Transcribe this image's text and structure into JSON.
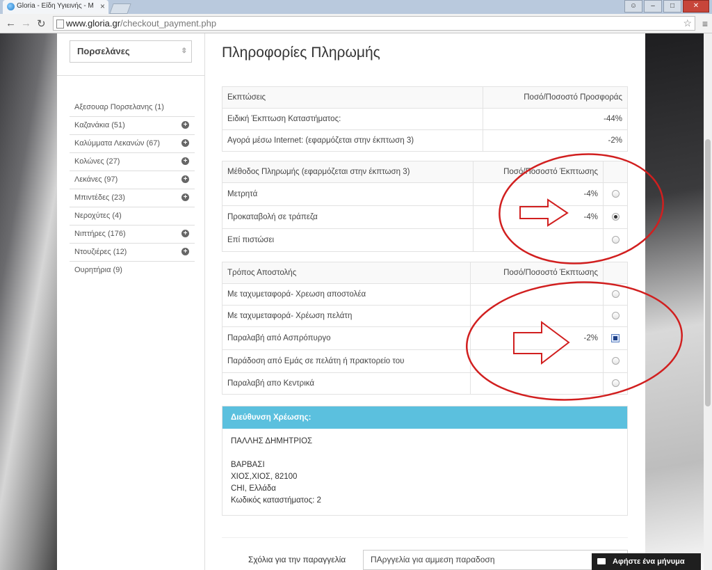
{
  "browser": {
    "tab_title": "Gloria - Είδη Υγιεινής - Μ",
    "url_domain": "www.gloria.gr",
    "url_path": "/checkout_payment.php"
  },
  "sidebar": {
    "category_select": "Πορσελάνες",
    "items": [
      {
        "label": "Αξεσουαρ Πορσελανης (1)",
        "expandable": false
      },
      {
        "label": "Καζανάκια (51)",
        "expandable": true
      },
      {
        "label": "Καλύμματα Λεκανών (67)",
        "expandable": true
      },
      {
        "label": "Κολώνες (27)",
        "expandable": true
      },
      {
        "label": "Λεκάνες (97)",
        "expandable": true
      },
      {
        "label": "Μπιντέδες (23)",
        "expandable": true
      },
      {
        "label": "Νεροχύτες (4)",
        "expandable": false
      },
      {
        "label": "Νιπτήρες (176)",
        "expandable": true
      },
      {
        "label": "Ντουζιέρες (12)",
        "expandable": true
      },
      {
        "label": "Ουρητήρια (9)",
        "expandable": false
      }
    ]
  },
  "main": {
    "title": "Πληροφορίες Πληρωμής",
    "discounts": {
      "header_left": "Εκπτώσεις",
      "header_right": "Ποσό/Ποσοστό Προσφοράς",
      "rows": [
        {
          "label": "Ειδική Έκπτωση Καταστήματος:",
          "value": "-44%"
        },
        {
          "label": "Αγορά μέσω Internet: (εφαρμόζεται στην έκπτωση 3)",
          "value": "-2%"
        }
      ]
    },
    "payment": {
      "header_left": "Μέθοδος Πληρωμής (εφαρμόζεται στην έκπτωση 3)",
      "header_right": "Ποσό/Ποσοστό Έκπτωσης",
      "rows": [
        {
          "label": "Μετρητά",
          "value": "-4%"
        },
        {
          "label": "Προκαταβολή σε τράπεζα",
          "value": "-4%"
        },
        {
          "label": "Επί πιστώσει",
          "value": ""
        }
      ]
    },
    "shipping": {
      "header_left": "Τρόπος Αποστολής",
      "header_right": "Ποσό/Ποσοστό Έκπτωσης",
      "rows": [
        {
          "label": "Με ταχυμεταφορά- Χρεωση αποστολέα",
          "value": ""
        },
        {
          "label": "Με ταχυμεταφορά- Χρέωση πελάτη",
          "value": ""
        },
        {
          "label": "Παραλαβή από Ασπρόπυργο",
          "value": "-2%"
        },
        {
          "label": "Παράδοση από Εμάς σε πελάτη ή πρακτορείο του",
          "value": ""
        },
        {
          "label": "Παραλαβή απο Κεντρικά",
          "value": ""
        }
      ]
    },
    "billing": {
      "header": "Διεύθυνση Χρέωσης:",
      "name": "ΠΑΛΛΗΣ ΔΗΜΗΤΡΙΟΣ",
      "line1": "ΒΑΡΒΑΣΙ",
      "line2": "ΧΙΟΣ,ΧΙΟΣ, 82100",
      "line3": "CHI, Ελλάδα",
      "line4": "Κωδικός καταστήματος: 2"
    },
    "notes": {
      "label": "Σχόλια για την παραγγελία",
      "value": "ΠΑργγελία για αμμεση παραδοση"
    }
  },
  "chat": {
    "label": "Αφήστε ένα μήνυμα"
  },
  "annotation_color": "#d11f1f"
}
